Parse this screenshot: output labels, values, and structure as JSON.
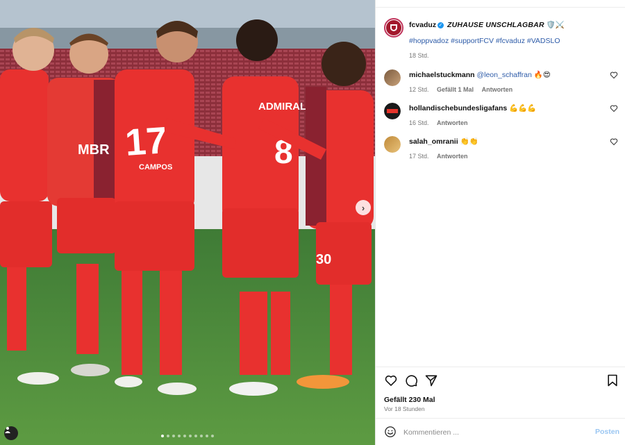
{
  "post": {
    "username": "fcvaduz",
    "caption": "ZUHAUSE UNSCHLAGBAR",
    "caption_emojis": "🛡️⚔️",
    "hashtags": "#hoppvadoz #supportFCV #fcvaduz #VADSLO",
    "time": "18 Std."
  },
  "comments": [
    {
      "username": "michaelstuckmann",
      "mention": "@leon_schaffran",
      "text": " 🔥😍",
      "time": "12 Std.",
      "likes": "Gefällt 1 Mal",
      "reply": "Antworten"
    },
    {
      "username": "hollandischebundesligafans",
      "mention": "",
      "text": " 💪💪💪",
      "time": "16 Std.",
      "likes": "",
      "reply": "Antworten"
    },
    {
      "username": "salah_omranii",
      "mention": "",
      "text": " 👏👏",
      "time": "17 Std.",
      "likes": "",
      "reply": "Antworten"
    }
  ],
  "jersey": {
    "sponsor_left": "MBR",
    "sponsor_right": "ADMIRAL",
    "number_left": "17",
    "name_left": "CAMPOS",
    "number_right": "8",
    "number_short": "30"
  },
  "footer": {
    "likes": "Gefällt 230 Mal",
    "ago": "Vor 18 Stunden",
    "placeholder": "Kommentieren ...",
    "post_button": "Posten"
  },
  "carousel": {
    "count": 10,
    "active": 0
  },
  "colors": {
    "accent": "#2d5ba8",
    "kit_red": "#e8312f",
    "kit_maroon": "#8a2230",
    "post_disabled": "#9ac6f2"
  },
  "icons": [
    "verified-icon",
    "heart-icon",
    "comment-icon",
    "share-icon",
    "bookmark-icon",
    "emoji-icon",
    "chevron-right-icon",
    "user-tag-icon"
  ]
}
